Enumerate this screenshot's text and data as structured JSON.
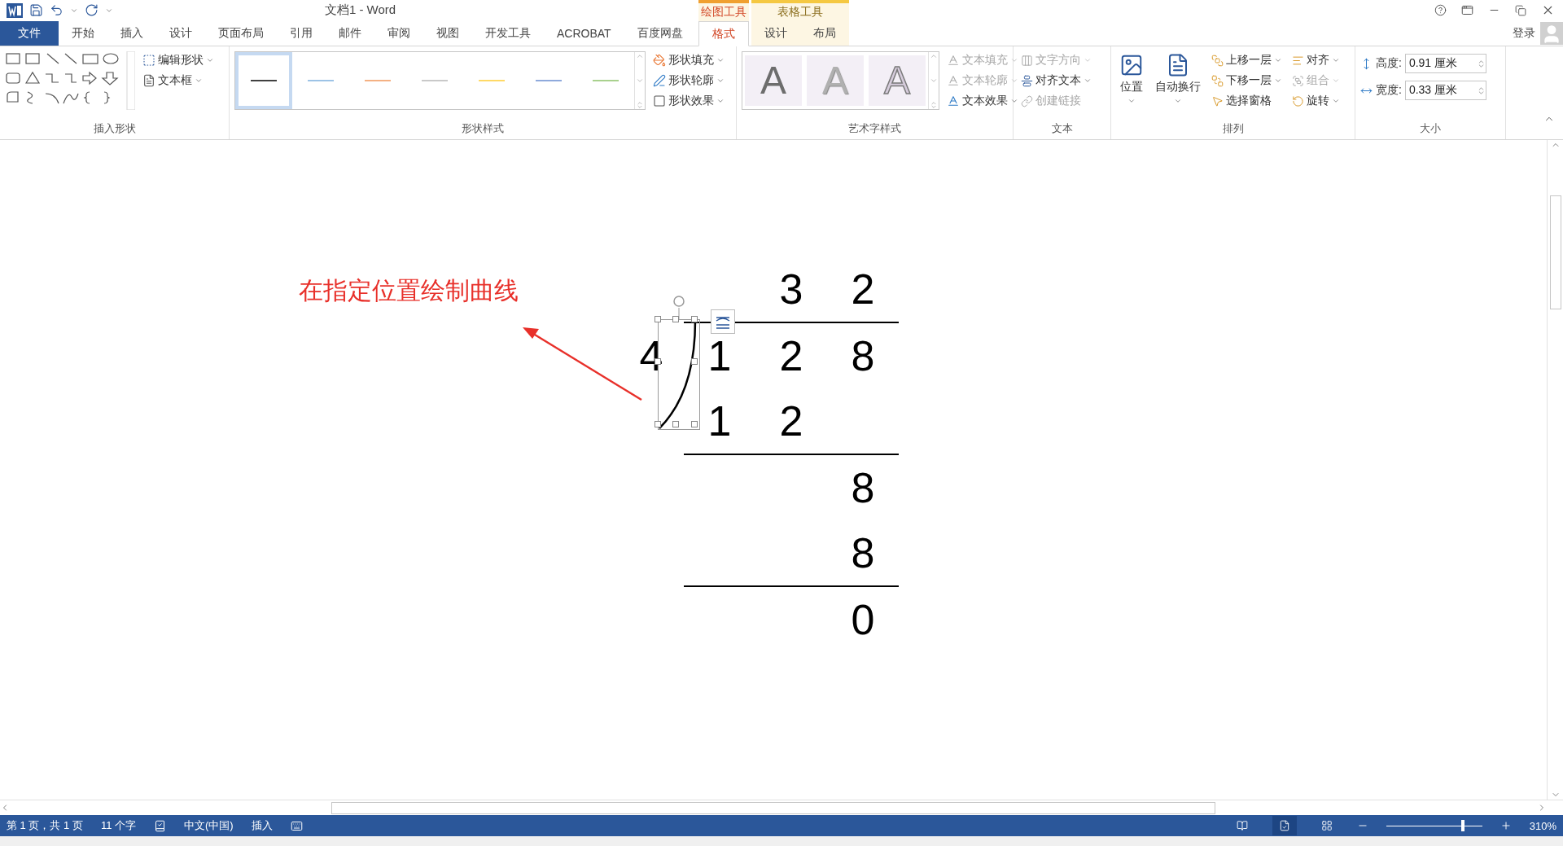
{
  "title_bar": {
    "title": "文档1 - Word"
  },
  "tabs": [
    {
      "label": "文件",
      "selected": false,
      "kind": "file"
    },
    {
      "label": "开始",
      "selected": false,
      "kind": "normal"
    },
    {
      "label": "插入",
      "selected": false,
      "kind": "normal"
    },
    {
      "label": "设计",
      "selected": false,
      "kind": "normal"
    },
    {
      "label": "页面布局",
      "selected": false,
      "kind": "normal"
    },
    {
      "label": "引用",
      "selected": false,
      "kind": "normal"
    },
    {
      "label": "邮件",
      "selected": false,
      "kind": "normal"
    },
    {
      "label": "审阅",
      "selected": false,
      "kind": "normal"
    },
    {
      "label": "视图",
      "selected": false,
      "kind": "normal"
    },
    {
      "label": "开发工具",
      "selected": false,
      "kind": "normal"
    },
    {
      "label": "ACROBAT",
      "selected": false,
      "kind": "normal"
    },
    {
      "label": "百度网盘",
      "selected": false,
      "kind": "normal"
    }
  ],
  "tool_groups": [
    {
      "label": "绘图工具",
      "color": "#f0a030",
      "tabs": [
        {
          "label": "格式",
          "selected": true
        }
      ]
    },
    {
      "label": "表格工具",
      "color": "#f5c842",
      "tabs": [
        {
          "label": "设计",
          "selected": false
        },
        {
          "label": "布局",
          "selected": false
        }
      ]
    }
  ],
  "account": {
    "label": "登录"
  },
  "ribbon": {
    "insert_shapes": {
      "label": "插入形状",
      "buttons": [
        {
          "label": "编辑形状"
        },
        {
          "label": "文本框"
        }
      ]
    },
    "shape_styles": {
      "label": "形状样式",
      "swatches": [
        {
          "color": "#404040",
          "selected": true
        },
        {
          "color": "#9dc3e6",
          "selected": false
        },
        {
          "color": "#f4b183",
          "selected": false
        },
        {
          "color": "#c9c9c9",
          "selected": false
        },
        {
          "color": "#ffd966",
          "selected": false
        },
        {
          "color": "#8faadc",
          "selected": false
        },
        {
          "color": "#a9d18e",
          "selected": false
        }
      ],
      "buttons": [
        {
          "label": "形状填充"
        },
        {
          "label": "形状轮廓"
        },
        {
          "label": "形状效果"
        }
      ]
    },
    "wordart_styles": {
      "label": "艺术字样式",
      "samples": [
        {
          "text": "A",
          "kind": "solid"
        },
        {
          "text": "A",
          "kind": "light"
        },
        {
          "text": "A",
          "kind": "outline"
        }
      ],
      "buttons": [
        {
          "label": "文本填充",
          "disabled": true
        },
        {
          "label": "文本轮廓",
          "disabled": true
        },
        {
          "label": "文本效果",
          "disabled": false
        }
      ]
    },
    "text": {
      "label": "文本",
      "buttons": [
        {
          "label": "文字方向",
          "disabled": true
        },
        {
          "label": "对齐文本",
          "disabled": false
        },
        {
          "label": "创建链接",
          "disabled": true
        }
      ]
    },
    "arrange": {
      "label": "排列",
      "large_buttons": [
        {
          "label": "位置"
        },
        {
          "label": "自动换行"
        }
      ],
      "buttons": [
        {
          "label": "上移一层",
          "disabled": false
        },
        {
          "label": "下移一层",
          "disabled": false
        },
        {
          "label": "选择窗格",
          "disabled": false
        },
        {
          "label": "对齐",
          "disabled": false
        },
        {
          "label": "组合",
          "disabled": true
        },
        {
          "label": "旋转",
          "disabled": false
        }
      ]
    },
    "size": {
      "label": "大小",
      "fields": [
        {
          "label": "高度:",
          "value": "0.91 厘米"
        },
        {
          "label": "宽度:",
          "value": "0.33 厘米"
        }
      ]
    }
  },
  "document": {
    "annotation": "在指定位置绘制曲线",
    "division": [
      {
        "cells": [
          "",
          "",
          "3",
          "2"
        ],
        "rule_below": true
      },
      {
        "cells": [
          "4",
          "1",
          "2",
          "8"
        ],
        "rule_below": false
      },
      {
        "cells": [
          "",
          "1",
          "2",
          ""
        ],
        "rule_below": true
      },
      {
        "cells": [
          "",
          "",
          "",
          "8"
        ],
        "rule_below": false
      },
      {
        "cells": [
          "",
          "",
          "",
          "8"
        ],
        "rule_below": true
      },
      {
        "cells": [
          "",
          "",
          "",
          "0"
        ],
        "rule_below": false
      }
    ]
  },
  "status_bar": {
    "items": [
      "第 1 页，共 1 页",
      "11 个字",
      "中文(中国)",
      "插入"
    ],
    "views": [
      {
        "selected": false
      },
      {
        "selected": true
      },
      {
        "selected": false
      }
    ],
    "zoom": {
      "level": 0.8,
      "reading": "310%"
    }
  }
}
